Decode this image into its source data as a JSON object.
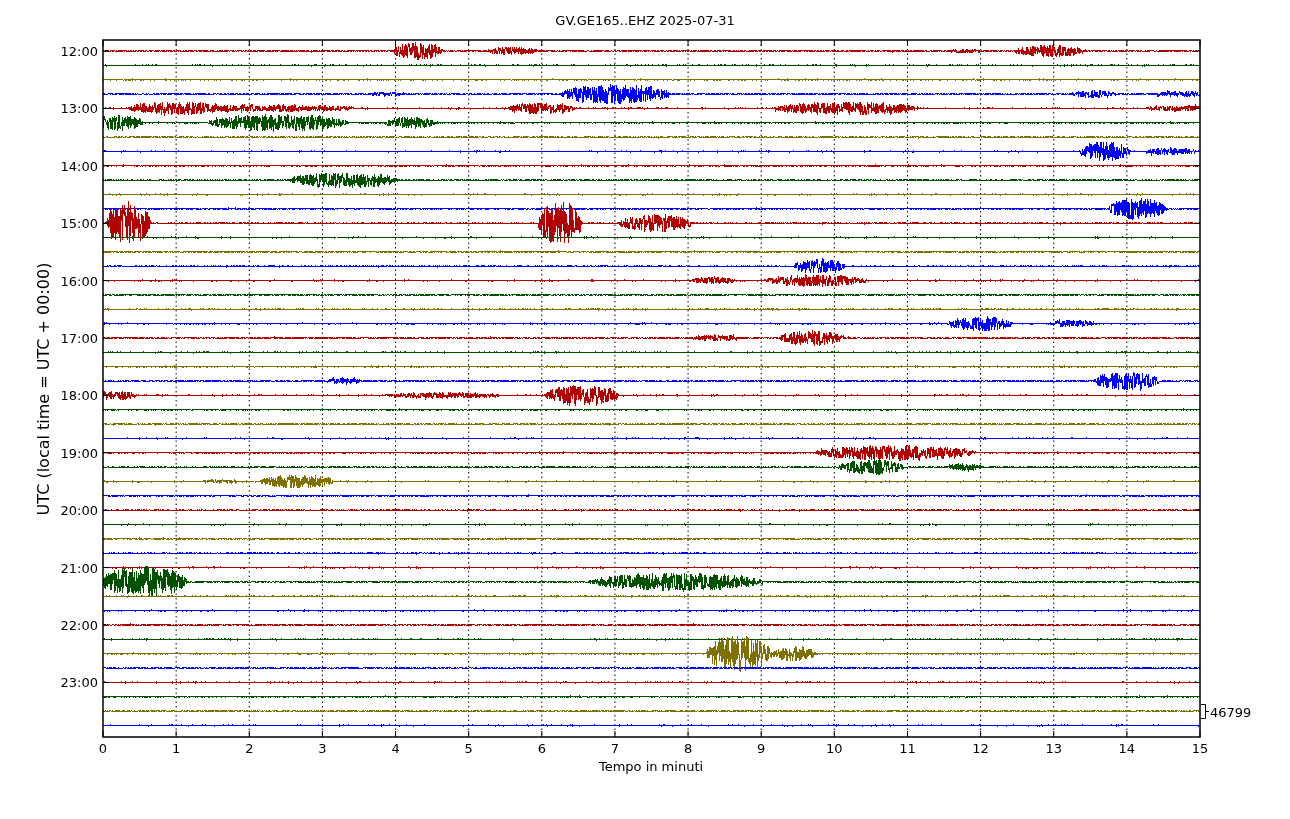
{
  "title": "GV.GE165..EHZ 2025-07-31",
  "ylabel": "UTC (local time = UTC + 00:00)",
  "xlabel": "Tempo in minuti",
  "yticks": [
    "12:00",
    "13:00",
    "14:00",
    "15:00",
    "16:00",
    "17:00",
    "18:00",
    "19:00",
    "20:00",
    "21:00",
    "22:00",
    "23:00"
  ],
  "xticks": [
    "0",
    "1",
    "2",
    "3",
    "4",
    "5",
    "6",
    "7",
    "8",
    "9",
    "10",
    "11",
    "12",
    "13",
    "14",
    "15"
  ],
  "scale_label": "46799",
  "traces": [
    {
      "color": "#b00000"
    },
    {
      "color": "#005000"
    },
    {
      "color": "#807000"
    },
    {
      "color": "#0000ff"
    },
    {
      "color": "#b00000"
    },
    {
      "color": "#005000"
    },
    {
      "color": "#807000"
    },
    {
      "color": "#0000ff"
    },
    {
      "color": "#b00000"
    },
    {
      "color": "#005000"
    },
    {
      "color": "#807000"
    },
    {
      "color": "#0000ff"
    },
    {
      "color": "#b00000"
    },
    {
      "color": "#005000"
    },
    {
      "color": "#807000"
    },
    {
      "color": "#0000ff"
    },
    {
      "color": "#b00000"
    },
    {
      "color": "#005000"
    },
    {
      "color": "#807000"
    },
    {
      "color": "#0000ff"
    },
    {
      "color": "#b00000"
    },
    {
      "color": "#005000"
    },
    {
      "color": "#807000"
    },
    {
      "color": "#0000ff"
    },
    {
      "color": "#b00000"
    },
    {
      "color": "#005000"
    },
    {
      "color": "#807000"
    },
    {
      "color": "#0000ff"
    },
    {
      "color": "#b00000"
    },
    {
      "color": "#005000"
    },
    {
      "color": "#807000"
    },
    {
      "color": "#0000ff"
    },
    {
      "color": "#b00000"
    },
    {
      "color": "#005000"
    },
    {
      "color": "#807000"
    },
    {
      "color": "#0000ff"
    },
    {
      "color": "#b00000"
    },
    {
      "color": "#005000"
    },
    {
      "color": "#807000"
    },
    {
      "color": "#0000ff"
    },
    {
      "color": "#b00000"
    },
    {
      "color": "#005000"
    },
    {
      "color": "#807000"
    },
    {
      "color": "#0000ff"
    },
    {
      "color": "#b00000"
    },
    {
      "color": "#005000"
    },
    {
      "color": "#807000"
    },
    {
      "color": "#0000ff"
    }
  ]
}
